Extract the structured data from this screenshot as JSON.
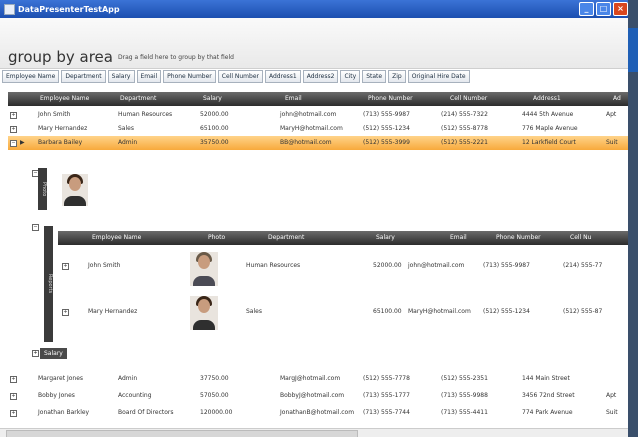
{
  "window": {
    "title": "DataPresenterTestApp"
  },
  "group_area": {
    "title": "group by area",
    "hint": "Drag a field here to group by that field"
  },
  "fields": [
    "Employee Name",
    "Department",
    "Salary",
    "Email",
    "Phone Number",
    "Cell Number",
    "Address1",
    "Address2",
    "City",
    "State",
    "Zip",
    "Original Hire Date"
  ],
  "columns": [
    "Employee Name",
    "Department",
    "Salary",
    "Email",
    "Phone Number",
    "Cell Number",
    "Address1",
    "Ad"
  ],
  "rows_top": [
    {
      "name": "John Smith",
      "dept": "Human Resources",
      "salary": "52000.00",
      "email": "john@hotmail.com",
      "phone": "(713) 555-9987",
      "cell": "(214) 555-7322",
      "addr1": "4444 5th Avenue",
      "addr2": "Apt"
    },
    {
      "name": "Mary Hernandez",
      "dept": "Sales",
      "salary": "65100.00",
      "email": "MaryH@hotmail.com",
      "phone": "(512) 555-1234",
      "cell": "(512) 555-8778",
      "addr1": "776 Maple Avenue",
      "addr2": ""
    },
    {
      "name": "Barbara Bailey",
      "dept": "Admin",
      "salary": "35750.00",
      "email": "BB@hotmail.com",
      "phone": "(512) 555-3999",
      "cell": "(512) 555-2221",
      "addr1": "12 Larkfield Court",
      "addr2": "Suit"
    }
  ],
  "sections": {
    "photo": "Photo",
    "reports": "Reports"
  },
  "sub_columns": [
    "Employee Name",
    "Photo",
    "Department",
    "Salary",
    "Email",
    "Phone Number",
    "Cell Nu"
  ],
  "sub_rows": [
    {
      "name": "John Smith",
      "dept": "Human Resources",
      "salary": "52000.00",
      "email": "john@hotmail.com",
      "phone": "(713) 555-9987",
      "cell": "(214) 555-77"
    },
    {
      "name": "Mary Hernandez",
      "dept": "Sales",
      "salary": "65100.00",
      "email": "MaryH@hotmail.com",
      "phone": "(512) 555-1234",
      "cell": "(512) 555-87"
    }
  ],
  "salary_button": "Salary",
  "rows_bottom": [
    {
      "name": "Margaret Jones",
      "dept": "Admin",
      "salary": "37750.00",
      "email": "MargJ@hotmail.com",
      "phone": "(512) 555-7778",
      "cell": "(512) 555-2351",
      "addr1": "144 Main Street",
      "addr2": ""
    },
    {
      "name": "Bobby Jones",
      "dept": "Accounting",
      "salary": "57050.00",
      "email": "BobbyJ@hotmail.com",
      "phone": "(713) 555-1777",
      "cell": "(713) 555-9988",
      "addr1": "3456 72nd Street",
      "addr2": "Apt"
    },
    {
      "name": "Jonathan Barkley",
      "dept": "Board Of Directors",
      "salary": "120000.00",
      "email": "JonathanB@hotmail.com",
      "phone": "(713) 555-7744",
      "cell": "(713) 555-4411",
      "addr1": "774 Park Avenue",
      "addr2": "Suit"
    }
  ]
}
